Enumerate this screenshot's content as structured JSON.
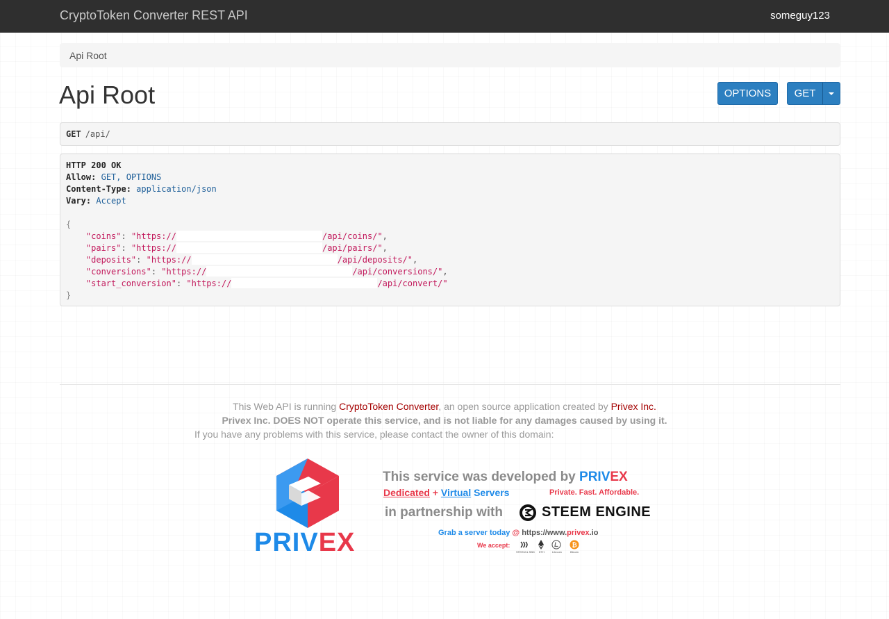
{
  "navbar": {
    "brand": "CryptoToken Converter REST API",
    "user": "someguy123"
  },
  "breadcrumb": {
    "item": "Api Root"
  },
  "page": {
    "title": "Api Root"
  },
  "buttons": {
    "options": "OPTIONS",
    "get": "GET"
  },
  "request": {
    "method": "GET",
    "path": "/api/"
  },
  "response": {
    "status": "HTTP 200 OK",
    "headers": [
      {
        "name": "Allow:",
        "value": "GET, OPTIONS"
      },
      {
        "name": "Content-Type:",
        "value": "application/json"
      },
      {
        "name": "Vary:",
        "value": "Accept"
      }
    ],
    "open_brace": "{",
    "close_brace": "}",
    "fields": [
      {
        "key": "\"coins\"",
        "prefix": "\"https://",
        "suffix": "/api/coins/\"",
        "comma": ","
      },
      {
        "key": "\"pairs\"",
        "prefix": "\"https://",
        "suffix": "/api/pairs/\"",
        "comma": ","
      },
      {
        "key": "\"deposits\"",
        "prefix": "\"https://",
        "suffix": "/api/deposits/\"",
        "comma": ","
      },
      {
        "key": "\"conversions\"",
        "prefix": "\"https://",
        "suffix": "/api/conversions/\"",
        "comma": ","
      },
      {
        "key": "\"start_conversion\"",
        "prefix": "\"https://",
        "suffix": "/api/convert/\"",
        "comma": ""
      }
    ]
  },
  "footer": {
    "line1_pre": "This Web API is running ",
    "line1_link": "CryptoToken Converter",
    "line1_mid": ", an open source application created by ",
    "line1_link2": "Privex Inc.",
    "line2": "Privex Inc. DOES NOT operate this service, and is not liable for any damages caused by using it.",
    "line3": "If you have any problems with this service, please contact the owner of this domain:"
  },
  "banner": {
    "logo_word_a": "PRIV",
    "logo_word_b": "EX",
    "developed_pre": "This service was developed by ",
    "developed_a": "PRIV",
    "developed_b": "EX",
    "dedicated": "Dedicated",
    "plus": " + ",
    "virtual": "Virtual",
    "servers": " Servers",
    "tagline": "Private. Fast. Affordable.",
    "partnership": "in partnership with",
    "steem_engine": "STEEM ENGINE",
    "grab_pre": "Grab a server today ",
    "grab_at": "@ ",
    "grab_url_a": "https://www.",
    "grab_url_b": "privex",
    "grab_url_c": ".io",
    "we_accept": "We accept:",
    "coins": [
      "STEEM & SBD",
      "ETH",
      "Litecoin",
      "Bitcoin"
    ]
  },
  "colors": {
    "navbar": "#2f2f2f",
    "button": "#2c7fc0",
    "privex_blue": "#1e8ae8",
    "privex_red": "#e8384a"
  }
}
